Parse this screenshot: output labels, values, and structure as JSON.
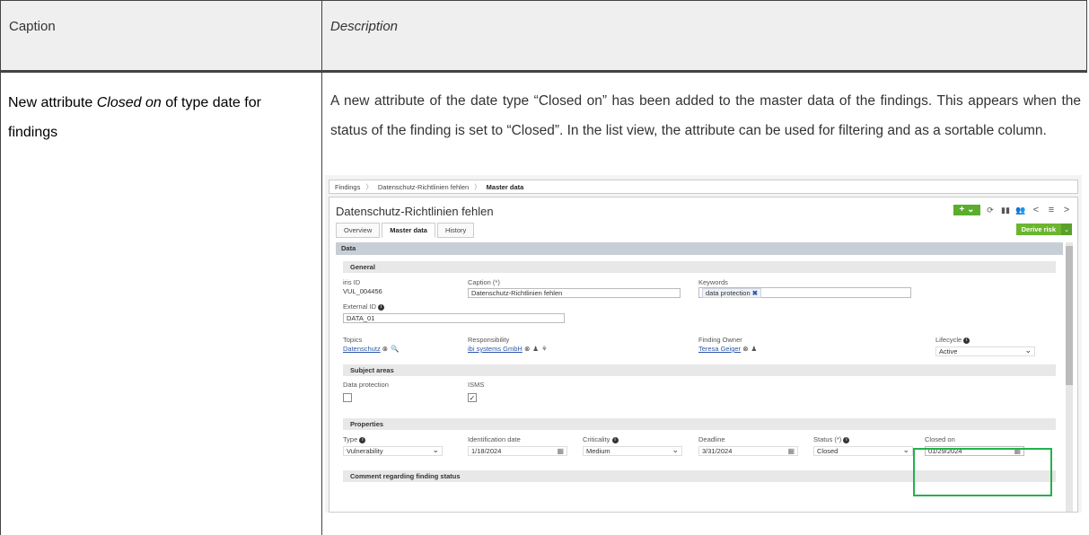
{
  "doc": {
    "header_caption": "Caption",
    "header_description": "Description",
    "row_caption_part1": "New attribute ",
    "row_caption_em": "Closed on",
    "row_caption_part2": " of type date for findings",
    "row_description": "A new attribute of the date type “Closed on” has been added to the master data of the findings. This appears when the status of the finding is set to “Closed”. In the list view, the attribute can be used for filtering and as a sortable column."
  },
  "app": {
    "breadcrumbs": [
      "Findings",
      "Datenschutz-Richtlinien fehlen",
      "Master data"
    ],
    "title": "Datenschutz-Richtlinien fehlen",
    "tabs": [
      "Overview",
      "Master data",
      "History"
    ],
    "active_tab": "Master data",
    "derive_risk_label": "Derive risk",
    "sections": {
      "data": "Data",
      "general": "General",
      "subject_areas": "Subject areas",
      "properties": "Properties",
      "comment": "Comment regarding finding status"
    },
    "general": {
      "iris_id_label": "iris ID",
      "iris_id_value": "VUL_004456",
      "caption_label": "Caption (*)",
      "caption_value": "Datenschutz-Richtlinien fehlen",
      "keywords_label": "Keywords",
      "keyword_tag": "data protection",
      "external_id_label": "External ID",
      "external_id_value": "DATA_01",
      "topics_label": "Topics",
      "topics_value": "Datenschutz",
      "responsibility_label": "Responsibility",
      "responsibility_value": "ibi systems GmbH",
      "finding_owner_label": "Finding Owner",
      "finding_owner_value": "Teresa Geiger",
      "lifecycle_label": "Lifecycle",
      "lifecycle_value": "Active"
    },
    "subject_areas": {
      "data_protection_label": "Data protection",
      "data_protection_checked": false,
      "isms_label": "ISMS",
      "isms_checked": true
    },
    "properties": {
      "type_label": "Type",
      "type_value": "Vulnerability",
      "identification_date_label": "Identification date",
      "identification_date_value": "1/18/2024",
      "criticality_label": "Criticality",
      "criticality_value": "Medium",
      "deadline_label": "Deadline",
      "deadline_value": "3/31/2024",
      "status_label": "Status (*)",
      "status_value": "Closed",
      "closed_on_label": "Closed on",
      "closed_on_value": "01/29/2024"
    },
    "colors": {
      "accent_green": "#5aad2d",
      "highlight": "#22b24c",
      "section_bar": "#c7ced6"
    }
  }
}
